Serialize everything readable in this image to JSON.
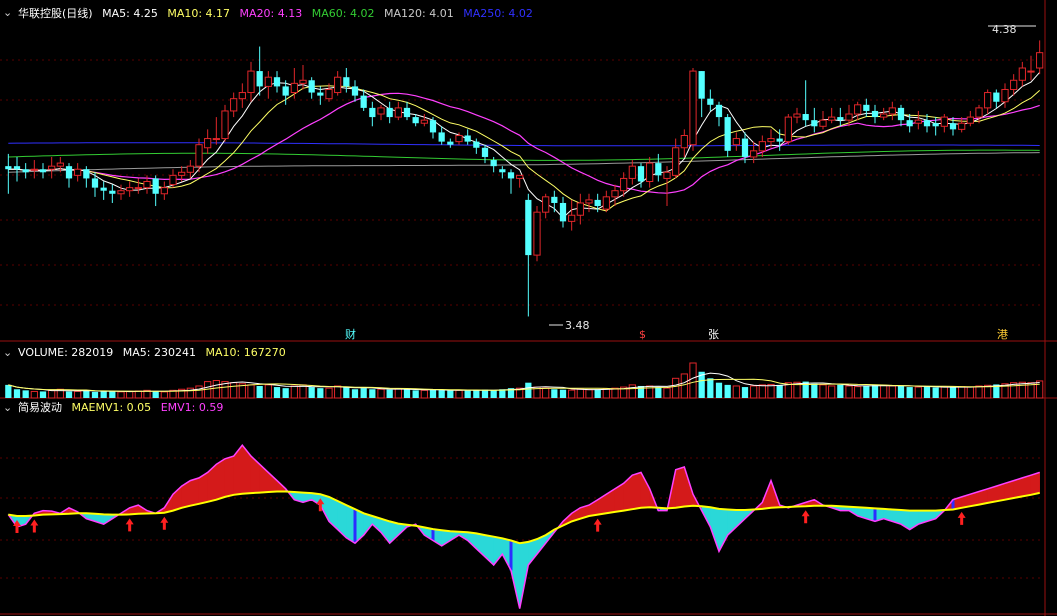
{
  "colors": {
    "up": "#e0262a",
    "down": "#54ffff",
    "ma5": "#ffffff",
    "ma10": "#ffff66",
    "ma20": "#ff40ff",
    "ma60": "#33cc33",
    "ma120": "#9a9a9a",
    "ma250": "#3030ff",
    "panel_border": "#9a1010",
    "grid": "#5a0000",
    "area_up": "#d41a1a",
    "area_down": "#2ad8d8",
    "emv_line": "#ff40ff",
    "maemv_line": "#ffff00",
    "bar_blue": "#2c2cff"
  },
  "main_panel": {
    "collapse_icon": "chevron-down-icon",
    "stock_label": "华联控股(日线)",
    "legend": [
      {
        "key": "ma5",
        "label": "MA5:",
        "value": "4.25"
      },
      {
        "key": "ma10",
        "label": "MA10:",
        "value": "4.17"
      },
      {
        "key": "ma20",
        "label": "MA20:",
        "value": "4.13"
      },
      {
        "key": "ma60",
        "label": "MA60:",
        "value": "4.02"
      },
      {
        "key": "ma120",
        "label": "MA120:",
        "value": "4.01"
      },
      {
        "key": "ma250",
        "label": "MA250:",
        "value": "4.02"
      }
    ],
    "high_label": "4.38",
    "low_label": "3.48",
    "event_marks": [
      "财",
      "$",
      "张",
      "港"
    ]
  },
  "volume_panel": {
    "collapse_icon": "chevron-down-icon",
    "legend": [
      {
        "key": "ma5",
        "text": "VOLUME: 282019"
      },
      {
        "key": "ma5",
        "text": "MA5: 230241"
      },
      {
        "key": "ma10",
        "text": "MA10: 167270"
      }
    ]
  },
  "emv_panel": {
    "collapse_icon": "chevron-down-icon",
    "legend": [
      {
        "key": "ma5",
        "text": "简易波动"
      },
      {
        "key": "ma10",
        "text": "MAEMV1: 0.05"
      },
      {
        "key": "ma20",
        "text": "EMV1: 0.59"
      }
    ]
  },
  "chart_data": {
    "type": "candlestick",
    "ylim": [
      3.4,
      4.44
    ],
    "candles": [
      [
        3.97,
        3.96,
        4.01,
        3.88
      ],
      [
        3.97,
        3.96,
        4.0,
        3.92
      ],
      [
        3.96,
        3.95,
        3.98,
        3.93
      ],
      [
        3.96,
        3.96,
        3.99,
        3.93
      ],
      [
        3.96,
        3.95,
        3.98,
        3.93
      ],
      [
        3.96,
        3.97,
        4.0,
        3.93
      ],
      [
        3.97,
        3.98,
        4.0,
        3.95
      ],
      [
        3.97,
        3.93,
        3.98,
        3.9
      ],
      [
        3.94,
        3.96,
        3.98,
        3.92
      ],
      [
        3.96,
        3.93,
        3.97,
        3.9
      ],
      [
        3.93,
        3.9,
        3.95,
        3.87
      ],
      [
        3.9,
        3.89,
        3.92,
        3.86
      ],
      [
        3.89,
        3.88,
        3.91,
        3.85
      ],
      [
        3.88,
        3.89,
        3.91,
        3.86
      ],
      [
        3.89,
        3.9,
        3.92,
        3.87
      ],
      [
        3.9,
        3.9,
        3.93,
        3.88
      ],
      [
        3.9,
        3.92,
        3.94,
        3.88
      ],
      [
        3.93,
        3.88,
        3.94,
        3.84
      ],
      [
        3.88,
        3.9,
        3.92,
        3.86
      ],
      [
        3.91,
        3.94,
        3.96,
        3.9
      ],
      [
        3.94,
        3.95,
        3.97,
        3.92
      ],
      [
        3.95,
        3.97,
        3.99,
        3.93
      ],
      [
        3.97,
        4.04,
        4.06,
        3.95
      ],
      [
        4.03,
        4.06,
        4.09,
        4.01
      ],
      [
        4.06,
        4.06,
        4.13,
        4.04
      ],
      [
        4.06,
        4.15,
        4.17,
        4.05
      ],
      [
        4.15,
        4.19,
        4.21,
        4.13
      ],
      [
        4.19,
        4.21,
        4.24,
        4.16
      ],
      [
        4.21,
        4.28,
        4.31,
        4.18
      ],
      [
        4.28,
        4.23,
        4.36,
        4.2
      ],
      [
        4.23,
        4.26,
        4.28,
        4.19
      ],
      [
        4.26,
        4.23,
        4.28,
        4.21
      ],
      [
        4.23,
        4.2,
        4.25,
        4.17
      ],
      [
        4.21,
        4.24,
        4.29,
        4.19
      ],
      [
        4.24,
        4.25,
        4.3,
        4.22
      ],
      [
        4.25,
        4.21,
        4.26,
        4.19
      ],
      [
        4.21,
        4.2,
        4.23,
        4.17
      ],
      [
        4.19,
        4.22,
        4.24,
        4.18
      ],
      [
        4.21,
        4.26,
        4.28,
        4.2
      ],
      [
        4.26,
        4.23,
        4.29,
        4.21
      ],
      [
        4.23,
        4.2,
        4.25,
        4.18
      ],
      [
        4.2,
        4.16,
        4.22,
        4.15
      ],
      [
        4.16,
        4.13,
        4.18,
        4.1
      ],
      [
        4.14,
        4.16,
        4.17,
        4.12
      ],
      [
        4.16,
        4.13,
        4.18,
        4.11
      ],
      [
        4.13,
        4.16,
        4.18,
        4.12
      ],
      [
        4.16,
        4.13,
        4.18,
        4.12
      ],
      [
        4.13,
        4.11,
        4.14,
        4.1
      ],
      [
        4.11,
        4.12,
        4.14,
        4.1
      ],
      [
        4.12,
        4.08,
        4.13,
        4.06
      ],
      [
        4.08,
        4.05,
        4.1,
        4.04
      ],
      [
        4.05,
        4.04,
        4.06,
        4.03
      ],
      [
        4.05,
        4.07,
        4.08,
        4.04
      ],
      [
        4.07,
        4.05,
        4.09,
        4.04
      ],
      [
        4.05,
        4.03,
        4.06,
        4.01
      ],
      [
        4.03,
        4.0,
        4.04,
        3.98
      ],
      [
        3.99,
        3.97,
        4.0,
        3.95
      ],
      [
        3.96,
        3.95,
        3.97,
        3.93
      ],
      [
        3.95,
        3.93,
        3.96,
        3.88
      ],
      [
        3.93,
        3.94,
        3.94,
        3.9
      ],
      [
        3.86,
        3.68,
        3.88,
        3.48
      ],
      [
        3.68,
        3.82,
        3.84,
        3.66
      ],
      [
        3.82,
        3.87,
        3.88,
        3.8
      ],
      [
        3.87,
        3.85,
        3.89,
        3.82
      ],
      [
        3.85,
        3.79,
        3.87,
        3.77
      ],
      [
        3.79,
        3.81,
        3.86,
        3.76
      ],
      [
        3.81,
        3.85,
        3.88,
        3.78
      ],
      [
        3.85,
        3.86,
        3.88,
        3.82
      ],
      [
        3.86,
        3.84,
        3.88,
        3.82
      ],
      [
        3.83,
        3.87,
        3.89,
        3.82
      ],
      [
        3.87,
        3.89,
        3.91,
        3.84
      ],
      [
        3.89,
        3.93,
        3.95,
        3.87
      ],
      [
        3.93,
        3.97,
        3.99,
        3.91
      ],
      [
        3.97,
        3.92,
        3.98,
        3.9
      ],
      [
        3.92,
        3.98,
        4.0,
        3.9
      ],
      [
        3.98,
        3.94,
        4.01,
        3.92
      ],
      [
        3.93,
        3.95,
        3.97,
        3.84
      ],
      [
        3.94,
        4.03,
        4.06,
        3.93
      ],
      [
        4.03,
        4.07,
        4.09,
        4.0
      ],
      [
        4.04,
        4.28,
        4.29,
        4.02
      ],
      [
        4.28,
        4.19,
        4.28,
        4.13
      ],
      [
        4.19,
        4.17,
        4.22,
        4.15
      ],
      [
        4.17,
        4.13,
        4.18,
        4.1
      ],
      [
        4.13,
        4.02,
        4.14,
        4.0
      ],
      [
        4.04,
        4.06,
        4.08,
        4.02
      ],
      [
        4.06,
        4.0,
        4.08,
        3.98
      ],
      [
        4.0,
        4.02,
        4.05,
        3.98
      ],
      [
        4.02,
        4.05,
        4.07,
        4.0
      ],
      [
        4.05,
        4.06,
        4.09,
        4.03
      ],
      [
        4.06,
        4.05,
        4.09,
        4.02
      ],
      [
        4.05,
        4.13,
        4.14,
        4.04
      ],
      [
        4.13,
        4.14,
        4.16,
        4.11
      ],
      [
        4.14,
        4.12,
        4.25,
        4.1
      ],
      [
        4.12,
        4.1,
        4.16,
        4.08
      ],
      [
        4.1,
        4.12,
        4.15,
        4.09
      ],
      [
        4.12,
        4.13,
        4.16,
        4.11
      ],
      [
        4.13,
        4.12,
        4.16,
        4.1
      ],
      [
        4.12,
        4.14,
        4.17,
        4.1
      ],
      [
        4.14,
        4.17,
        4.18,
        4.12
      ],
      [
        4.17,
        4.15,
        4.19,
        4.13
      ],
      [
        4.15,
        4.13,
        4.17,
        4.11
      ],
      [
        4.13,
        4.14,
        4.16,
        4.12
      ],
      [
        4.14,
        4.16,
        4.18,
        4.12
      ],
      [
        4.16,
        4.12,
        4.17,
        4.1
      ],
      [
        4.12,
        4.1,
        4.14,
        4.08
      ],
      [
        4.11,
        4.12,
        4.15,
        4.09
      ],
      [
        4.12,
        4.1,
        4.14,
        4.08
      ],
      [
        4.11,
        4.1,
        4.13,
        4.07
      ],
      [
        4.1,
        4.13,
        4.14,
        4.08
      ],
      [
        4.11,
        4.09,
        4.13,
        4.07
      ],
      [
        4.09,
        4.11,
        4.13,
        4.08
      ],
      [
        4.11,
        4.13,
        4.15,
        4.1
      ],
      [
        4.13,
        4.16,
        4.17,
        4.11
      ],
      [
        4.16,
        4.21,
        4.22,
        4.14
      ],
      [
        4.21,
        4.18,
        4.22,
        4.16
      ],
      [
        4.18,
        4.22,
        4.24,
        4.16
      ],
      [
        4.22,
        4.25,
        4.27,
        4.2
      ],
      [
        4.25,
        4.29,
        4.31,
        4.23
      ],
      [
        4.28,
        4.28,
        4.33,
        4.25
      ],
      [
        4.29,
        4.34,
        4.38,
        4.27
      ]
    ],
    "volume": [
      60,
      40,
      35,
      30,
      30,
      35,
      40,
      30,
      30,
      35,
      28,
      30,
      30,
      28,
      30,
      32,
      35,
      30,
      28,
      35,
      40,
      45,
      55,
      75,
      80,
      75,
      70,
      65,
      60,
      55,
      60,
      50,
      45,
      55,
      60,
      50,
      45,
      45,
      55,
      50,
      40,
      45,
      40,
      40,
      38,
      42,
      40,
      35,
      35,
      38,
      36,
      34,
      35,
      34,
      35,
      38,
      36,
      40,
      45,
      45,
      70,
      50,
      45,
      40,
      38,
      36,
      40,
      38,
      40,
      42,
      45,
      50,
      60,
      55,
      55,
      50,
      45,
      90,
      110,
      160,
      120,
      90,
      70,
      60,
      55,
      50,
      55,
      60,
      62,
      60,
      70,
      72,
      75,
      65,
      60,
      55,
      60,
      55,
      52,
      55,
      60,
      58,
      55,
      55,
      50,
      50,
      52,
      48,
      50,
      50,
      52,
      50,
      55,
      58,
      62,
      65,
      70,
      72,
      70,
      78
    ],
    "emv": [
      0.05,
      -0.4,
      -0.3,
      0.1,
      0.2,
      0.18,
      0.1,
      0.3,
      0.15,
      -0.1,
      -0.2,
      -0.3,
      -0.1,
      0.1,
      0.3,
      0.4,
      0.2,
      0.1,
      0.3,
      0.8,
      1.1,
      1.3,
      1.4,
      1.6,
      1.9,
      2.1,
      2.2,
      2.6,
      2.2,
      1.9,
      1.6,
      1.3,
      1.0,
      0.6,
      0.5,
      0.6,
      0.4,
      -0.2,
      -0.5,
      -0.8,
      -1.0,
      -0.7,
      -0.3,
      -0.6,
      -1.0,
      -0.7,
      -0.4,
      -0.3,
      -0.7,
      -0.9,
      -1.1,
      -0.9,
      -0.7,
      -0.9,
      -1.2,
      -1.5,
      -1.8,
      -1.4,
      -2.0,
      -3.4,
      -1.8,
      -1.4,
      -1.0,
      -0.6,
      -0.2,
      0.1,
      0.3,
      0.4,
      0.6,
      0.8,
      1.0,
      1.2,
      1.5,
      1.6,
      1.0,
      0.2,
      0.2,
      1.7,
      1.8,
      0.8,
      0.2,
      -0.4,
      -1.3,
      -0.7,
      -0.4,
      -0.1,
      0.2,
      0.5,
      1.3,
      0.4,
      0.3,
      0.4,
      0.5,
      0.6,
      0.4,
      0.3,
      0.2,
      0.2,
      0.0,
      -0.1,
      -0.2,
      -0.1,
      -0.2,
      -0.3,
      -0.5,
      -0.3,
      -0.2,
      -0.1,
      0.2,
      0.6,
      0.7,
      0.8,
      0.9,
      1.0,
      1.1,
      1.2,
      1.3,
      1.4,
      1.5,
      1.6
    ],
    "maemv": [
      0.05,
      0.0,
      0.0,
      0.02,
      0.05,
      0.06,
      0.07,
      0.08,
      0.1,
      0.1,
      0.08,
      0.06,
      0.05,
      0.05,
      0.06,
      0.08,
      0.09,
      0.1,
      0.12,
      0.2,
      0.3,
      0.38,
      0.45,
      0.52,
      0.6,
      0.7,
      0.78,
      0.82,
      0.84,
      0.86,
      0.88,
      0.9,
      0.9,
      0.88,
      0.86,
      0.84,
      0.8,
      0.7,
      0.55,
      0.4,
      0.25,
      0.1,
      0.0,
      -0.1,
      -0.2,
      -0.28,
      -0.32,
      -0.36,
      -0.42,
      -0.48,
      -0.52,
      -0.56,
      -0.58,
      -0.6,
      -0.64,
      -0.7,
      -0.76,
      -0.82,
      -0.9,
      -1.0,
      -0.95,
      -0.85,
      -0.7,
      -0.5,
      -0.35,
      -0.2,
      -0.1,
      0.0,
      0.05,
      0.1,
      0.15,
      0.2,
      0.25,
      0.3,
      0.32,
      0.3,
      0.28,
      0.3,
      0.35,
      0.38,
      0.36,
      0.32,
      0.26,
      0.24,
      0.22,
      0.22,
      0.24,
      0.26,
      0.3,
      0.32,
      0.33,
      0.35,
      0.36,
      0.38,
      0.38,
      0.38,
      0.36,
      0.34,
      0.32,
      0.3,
      0.28,
      0.26,
      0.24,
      0.22,
      0.2,
      0.2,
      0.2,
      0.2,
      0.22,
      0.24,
      0.3,
      0.36,
      0.42,
      0.48,
      0.54,
      0.6,
      0.66,
      0.72,
      0.78,
      0.85
    ],
    "emv_ylim": [
      -3.6,
      3.6
    ]
  }
}
